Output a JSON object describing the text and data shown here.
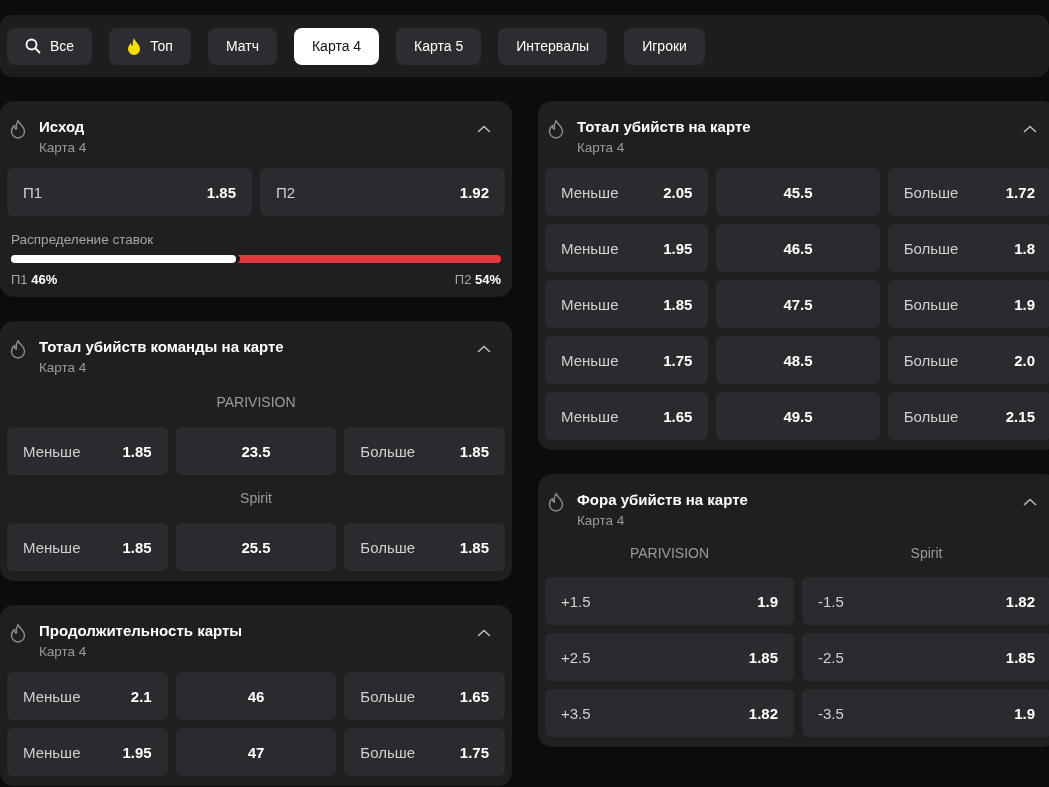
{
  "filter_tabs": [
    {
      "label": "Все",
      "kind": "search",
      "selected": false
    },
    {
      "label": "Топ",
      "kind": "fire",
      "selected": false
    },
    {
      "label": "Матч",
      "kind": "plain",
      "selected": false
    },
    {
      "label": "Карта 4",
      "kind": "plain",
      "selected": true
    },
    {
      "label": "Карта 5",
      "kind": "plain",
      "selected": false
    },
    {
      "label": "Интервалы",
      "kind": "plain",
      "selected": false
    },
    {
      "label": "Игроки",
      "kind": "plain",
      "selected": false
    }
  ],
  "columns": [
    {
      "markets": [
        {
          "kind": "two_way",
          "title": "Исход",
          "subtitle": "Карта 4",
          "expanded": true,
          "outcomes": [
            {
              "label": "П1",
              "odds": "1.85"
            },
            {
              "label": "П2",
              "odds": "1.92"
            }
          ],
          "distribution": {
            "label": "Распределение ставок",
            "level": 0.46,
            "sides": [
              {
                "name": "П1",
                "share": "46%"
              },
              {
                "name": "П2",
                "share": "54%"
              }
            ]
          }
        },
        {
          "kind": "team_totals",
          "title": "Тотал убийств команды на карте",
          "subtitle": "Карта 4",
          "expanded": true,
          "groups": [
            {
              "team": "PARIVISION",
              "rows": [
                {
                  "under_label": "Меньше",
                  "under": "1.85",
                  "line": "23.5",
                  "over_label": "Больше",
                  "over": "1.85"
                }
              ]
            },
            {
              "team": "Spirit",
              "rows": [
                {
                  "under_label": "Меньше",
                  "under": "1.85",
                  "line": "25.5",
                  "over_label": "Больше",
                  "over": "1.85"
                }
              ]
            }
          ]
        },
        {
          "kind": "totals",
          "title": "Продолжительность карты",
          "subtitle": "Карта 4",
          "expanded": true,
          "rows": [
            {
              "under_label": "Меньше",
              "under": "2.1",
              "line": "46",
              "over_label": "Больше",
              "over": "1.65"
            },
            {
              "under_label": "Меньше",
              "under": "1.95",
              "line": "47",
              "over_label": "Больше",
              "over": "1.75"
            }
          ]
        }
      ]
    },
    {
      "markets": [
        {
          "kind": "totals",
          "title": "Тотал убийств на карте",
          "subtitle": "Карта 4",
          "expanded": true,
          "rows": [
            {
              "under_label": "Меньше",
              "under": "2.05",
              "line": "45.5",
              "over_label": "Больше",
              "over": "1.72"
            },
            {
              "under_label": "Меньше",
              "under": "1.95",
              "line": "46.5",
              "over_label": "Больше",
              "over": "1.8"
            },
            {
              "under_label": "Меньше",
              "under": "1.85",
              "line": "47.5",
              "over_label": "Больше",
              "over": "1.9"
            },
            {
              "under_label": "Меньше",
              "under": "1.75",
              "line": "48.5",
              "over_label": "Больше",
              "over": "2.0"
            },
            {
              "under_label": "Меньше",
              "under": "1.65",
              "line": "49.5",
              "over_label": "Больше",
              "over": "2.15"
            }
          ]
        },
        {
          "kind": "handicap",
          "title": "Фора убийств на карте",
          "subtitle": "Карта 4",
          "expanded": true,
          "teams": [
            "PARIVISION",
            "Spirit"
          ],
          "rows": [
            [
              {
                "label": "+1.5",
                "odds": "1.9"
              },
              {
                "label": "-1.5",
                "odds": "1.82"
              }
            ],
            [
              {
                "label": "+2.5",
                "odds": "1.85"
              },
              {
                "label": "-2.5",
                "odds": "1.85"
              }
            ],
            [
              {
                "label": "+3.5",
                "odds": "1.82"
              },
              {
                "label": "-3.5",
                "odds": "1.9"
              }
            ]
          ]
        }
      ]
    }
  ]
}
